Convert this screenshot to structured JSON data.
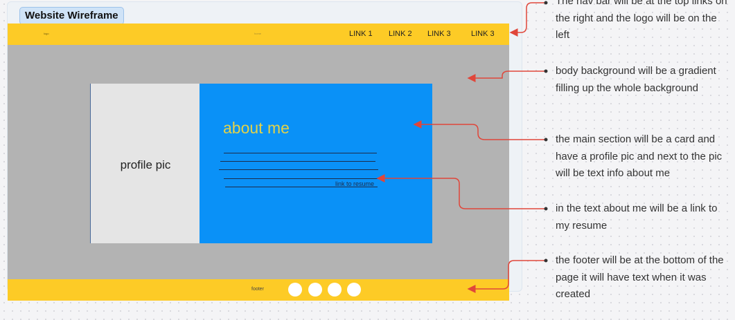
{
  "frame": {
    "title": "Website Wireframe"
  },
  "navbar": {
    "logo_text": "logo",
    "center_text": "home",
    "links": [
      "LINK 1",
      "LINK 2",
      "LINK 3",
      "LINK 3"
    ]
  },
  "card": {
    "profile_label": "profile pic",
    "about_title": "about me",
    "resume_link": "link to resume"
  },
  "footer": {
    "text": "footer",
    "circle_count": 4
  },
  "notes": [
    "The nav bar will be at the top links on the right and the logo will be on the left",
    "body background will be a gradient filling up the whole background",
    "the main section will be a card and have a profile pic and next to the pic will be text info about me",
    "in the text about me will be a link to my resume",
    "the footer will be at the bottom of the page it will have text when it was created"
  ],
  "colors": {
    "nav_footer": "#fdcb26",
    "body_bg": "#b3b3b3",
    "card_blue": "#0a91f7",
    "title_yellow": "#e2d24a",
    "arrow_red": "#e0463a"
  }
}
